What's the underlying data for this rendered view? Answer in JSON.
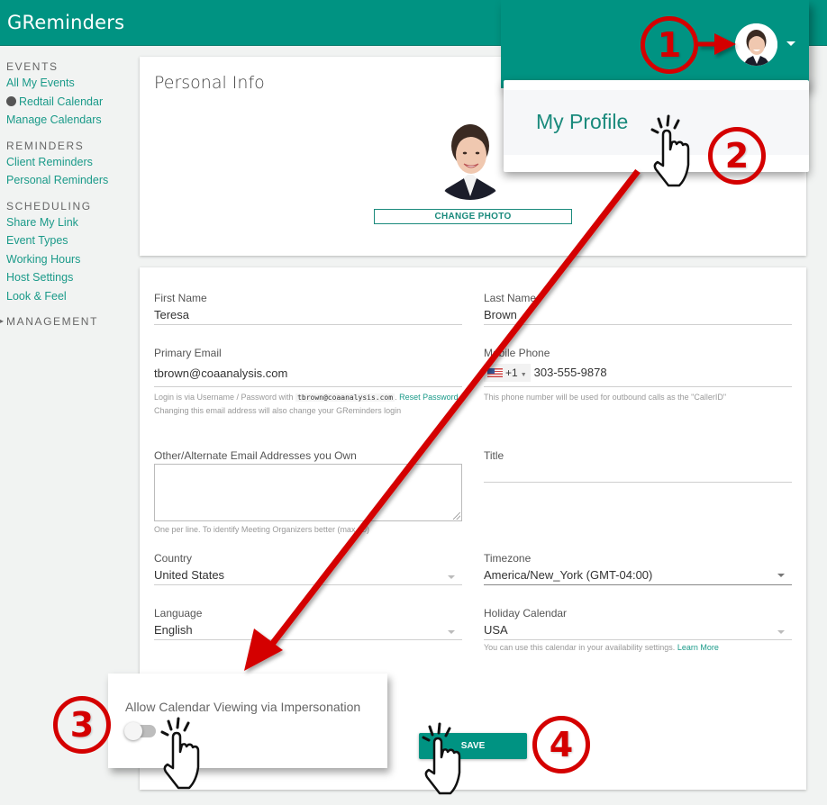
{
  "app": {
    "title": "GReminders"
  },
  "sidebar": {
    "sections": [
      {
        "heading": "EVENTS",
        "items": [
          {
            "label": "All My Events"
          },
          {
            "label": "Redtail Calendar",
            "has_dot": true
          },
          {
            "label": "Manage Calendars"
          }
        ]
      },
      {
        "heading": "REMINDERS",
        "items": [
          {
            "label": "Client Reminders"
          },
          {
            "label": "Personal Reminders"
          }
        ]
      },
      {
        "heading": "SCHEDULING",
        "items": [
          {
            "label": "Share My Link"
          },
          {
            "label": "Event Types"
          },
          {
            "label": "Working Hours"
          },
          {
            "label": "Host Settings"
          },
          {
            "label": "Look & Feel"
          }
        ]
      },
      {
        "heading": "MANAGEMENT",
        "collapsed": true,
        "items": []
      }
    ]
  },
  "user_menu": {
    "items": [
      {
        "label": "My Profile"
      }
    ]
  },
  "personal_info": {
    "title": "Personal Info",
    "change_photo_label": "CHANGE PHOTO"
  },
  "form": {
    "first_name": {
      "label": "First Name",
      "value": "Teresa"
    },
    "last_name": {
      "label": "Last Name",
      "value": "Brown"
    },
    "primary_email": {
      "label": "Primary Email",
      "value": "tbrown@coaanalysis.com",
      "hint_prefix": "Login is via Username / Password with",
      "hint_code": "tbrown@coaanalysis.com",
      "hint_link": "Reset Password",
      "hint_line2": "Changing this email address will also change your GReminders login"
    },
    "mobile_phone": {
      "label": "Mobile Phone",
      "country_code": "+1",
      "value": "303-555-9878",
      "hint": "This phone number will be used for outbound calls as the \"CallerID\""
    },
    "alternate_emails": {
      "label": "Other/Alternate Email Addresses you Own",
      "value": "",
      "hint": "One per line. To identify Meeting Organizers better (max 10)"
    },
    "title": {
      "label": "Title",
      "value": ""
    },
    "country": {
      "label": "Country",
      "value": "United States"
    },
    "timezone": {
      "label": "Timezone",
      "value": "America/New_York (GMT-04:00)"
    },
    "language": {
      "label": "Language",
      "value": "English"
    },
    "holiday_calendar": {
      "label": "Holiday Calendar",
      "value": "USA",
      "hint": "You can use this calendar in your availability settings.",
      "hint_link": "Learn More"
    },
    "impersonation": {
      "label": "Allow Calendar Viewing via Impersonation",
      "enabled": false
    },
    "save_label": "SAVE"
  },
  "annotations": {
    "steps": [
      "1",
      "2",
      "3",
      "4"
    ],
    "color": "#d40000"
  },
  "colors": {
    "brand": "#009382",
    "link": "#1a9a89"
  }
}
